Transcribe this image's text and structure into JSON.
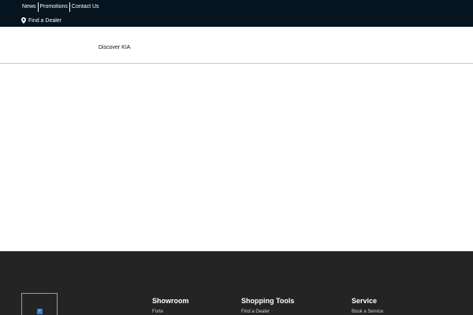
{
  "topbar": {
    "links": [
      "News",
      "Promotions",
      "Contact Us"
    ],
    "dealer_label": "Find a Dealer",
    "dealer_icon": "map-pin-icon"
  },
  "nav": {
    "items": [
      "Discover KIA"
    ]
  },
  "footer": {
    "logo_icon": "kia-logo-icon",
    "columns": [
      {
        "title": "Showroom",
        "first_link": "Forte"
      },
      {
        "title": "Shopping Tools",
        "first_link": "Find a Dealer"
      },
      {
        "title": "Service",
        "first_link": "Book a Service"
      }
    ]
  },
  "colors": {
    "topbar_bg": "#05141f",
    "footer_bg": "#242424",
    "text_light": "#ffffff"
  }
}
